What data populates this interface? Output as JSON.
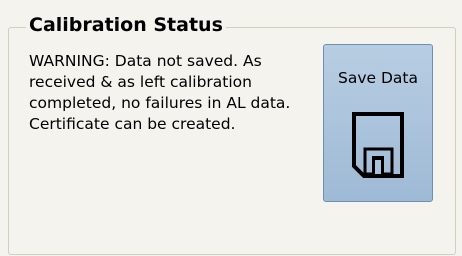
{
  "calibration": {
    "group_title": "Calibration Status",
    "status_message": "WARNING: Data not saved. As received & as left calibration completed, no failures in AL data. Certificate can be created.",
    "save_button_label": "Save Data",
    "save_button_icon": "floppy-disk-icon"
  },
  "colors": {
    "panel_background": "#f4f3ee",
    "button_fill": "#a9c2dc",
    "button_border": "#6f8fae"
  }
}
